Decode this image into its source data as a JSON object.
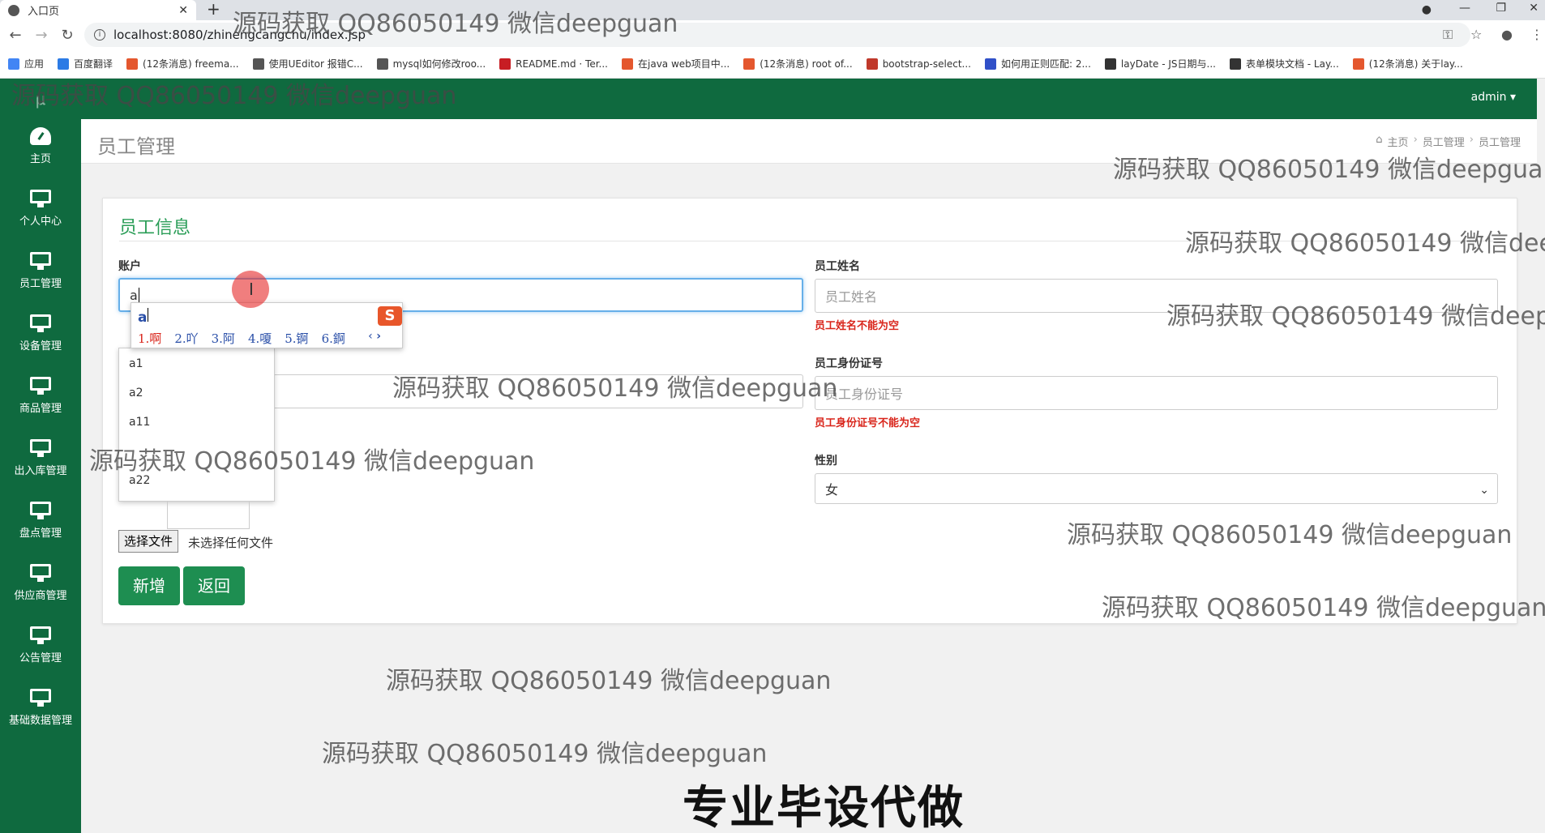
{
  "browser": {
    "tab_title": "入口页",
    "tab_close": "✕",
    "new_tab": "+",
    "url": "localhost:8080/zhinengcangchu/index.jsp",
    "bookmarks": [
      {
        "label": "应用",
        "color": "#4285f4"
      },
      {
        "label": "百度翻译",
        "color": "#2c7be5"
      },
      {
        "label": "(12条消息) freema...",
        "color": "#e4572e"
      },
      {
        "label": "使用UEditor 报错C...",
        "color": "#555555"
      },
      {
        "label": "mysql如何修改roo...",
        "color": "#555555"
      },
      {
        "label": "README.md · Ter...",
        "color": "#c71d23"
      },
      {
        "label": "在java web项目中...",
        "color": "#e4572e"
      },
      {
        "label": "(12条消息) root of...",
        "color": "#e4572e"
      },
      {
        "label": "bootstrap-select...",
        "color": "#c0392b"
      },
      {
        "label": "如何用正则匹配: 2...",
        "color": "#3050c8"
      },
      {
        "label": "layDate - JS日期与...",
        "color": "#333333"
      },
      {
        "label": "表单模块文档 - Lay...",
        "color": "#333333"
      },
      {
        "label": "(12条消息) 关于lay...",
        "color": "#e4572e"
      }
    ]
  },
  "app": {
    "user_menu": "admin ▾",
    "logo_text": "μ",
    "sidebar": [
      {
        "label": "主页",
        "icon": "dashboard-icon"
      },
      {
        "label": "个人中心",
        "icon": "monitor-icon"
      },
      {
        "label": "员工管理",
        "icon": "monitor-icon"
      },
      {
        "label": "设备管理",
        "icon": "monitor-icon"
      },
      {
        "label": "商品管理",
        "icon": "monitor-icon"
      },
      {
        "label": "出入库管理",
        "icon": "monitor-icon"
      },
      {
        "label": "盘点管理",
        "icon": "monitor-icon"
      },
      {
        "label": "供应商管理",
        "icon": "monitor-icon"
      },
      {
        "label": "公告管理",
        "icon": "monitor-icon"
      },
      {
        "label": "基础数据管理",
        "icon": "monitor-icon"
      }
    ],
    "page_title": "员工管理",
    "breadcrumb": [
      "主页",
      "员工管理",
      "员工管理"
    ],
    "panel_title": "员工信息"
  },
  "form": {
    "account_label": "账户",
    "account_value": "a",
    "name_label": "员工姓名",
    "name_placeholder": "员工姓名",
    "name_error": "员工姓名不能为空",
    "idcard_label": "员工身份证号",
    "idcard_placeholder": "员工身份证号",
    "idcard_error": "员工身份证号不能为空",
    "gender_label": "性别",
    "gender_value": "女",
    "file_button": "选择文件",
    "file_status": "未选择任何文件",
    "add_button": "新增",
    "back_button": "返回"
  },
  "autocomplete": [
    "a1",
    "a2",
    "a11",
    "a22"
  ],
  "ime": {
    "composition": "a",
    "candidates": [
      "1.啊",
      "2.吖",
      "3.阿",
      "4.嗄",
      "5.锕",
      "6.錒"
    ],
    "logo": "S"
  },
  "overlay": {
    "watermark": "源码获取 QQ86050149 微信deepguan",
    "banner": "专业毕设代做"
  },
  "colors": {
    "brand_green": "#0f6a3f",
    "button_green": "#1e8e51",
    "error_red": "#d9251b",
    "title_green": "#2a9d57"
  }
}
